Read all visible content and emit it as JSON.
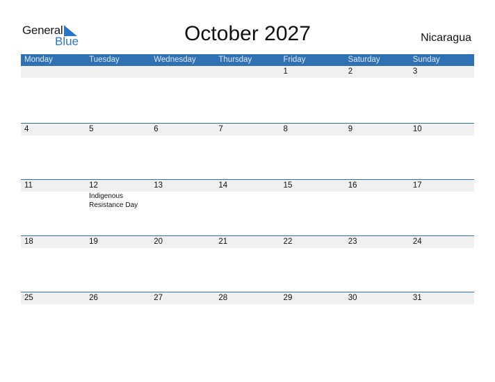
{
  "logo": {
    "line1": "General",
    "line2": "Blue"
  },
  "title": "October 2027",
  "country": "Nicaragua",
  "colors": {
    "header": "#2f71b2",
    "logo_blue": "#2a76c6",
    "date_strip": "#f0f0f0"
  },
  "weekdays": [
    "Monday",
    "Tuesday",
    "Wednesday",
    "Thursday",
    "Friday",
    "Saturday",
    "Sunday"
  ],
  "weeks": [
    [
      {
        "day": ""
      },
      {
        "day": ""
      },
      {
        "day": ""
      },
      {
        "day": ""
      },
      {
        "day": "1"
      },
      {
        "day": "2"
      },
      {
        "day": "3"
      }
    ],
    [
      {
        "day": "4"
      },
      {
        "day": "5"
      },
      {
        "day": "6"
      },
      {
        "day": "7"
      },
      {
        "day": "8"
      },
      {
        "day": "9"
      },
      {
        "day": "10"
      }
    ],
    [
      {
        "day": "11"
      },
      {
        "day": "12",
        "holiday": "Indigenous Resistance Day"
      },
      {
        "day": "13"
      },
      {
        "day": "14"
      },
      {
        "day": "15"
      },
      {
        "day": "16"
      },
      {
        "day": "17"
      }
    ],
    [
      {
        "day": "18"
      },
      {
        "day": "19"
      },
      {
        "day": "20"
      },
      {
        "day": "21"
      },
      {
        "day": "22"
      },
      {
        "day": "23"
      },
      {
        "day": "24"
      }
    ],
    [
      {
        "day": "25"
      },
      {
        "day": "26"
      },
      {
        "day": "27"
      },
      {
        "day": "28"
      },
      {
        "day": "29"
      },
      {
        "day": "30"
      },
      {
        "day": "31"
      }
    ]
  ]
}
